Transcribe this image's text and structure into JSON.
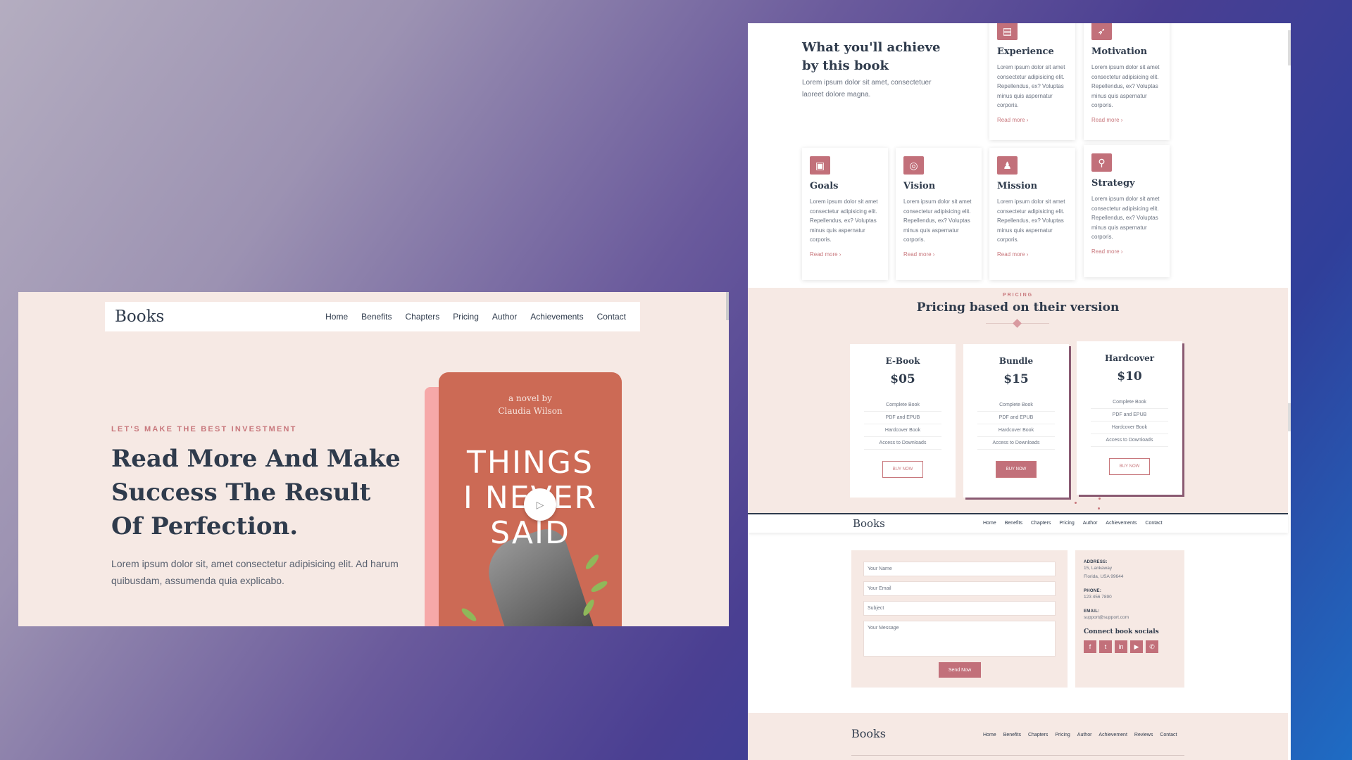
{
  "hero": {
    "brand": "Books",
    "nav": [
      "Home",
      "Benefits",
      "Chapters",
      "Pricing",
      "Author",
      "Achievements",
      "Contact"
    ],
    "tagline": "LET'S MAKE THE BEST INVESTMENT",
    "headline": "Read More And Make Success The Result Of Perfection.",
    "description": "Lorem ipsum dolor sit, amet consectetur adipisicing elit. Ad harum quibusdam, assumenda quia explicabo.",
    "book": {
      "byline": "a novel by",
      "author": "Claudia Wilson",
      "title_1": "THINGS",
      "title_2": "I NEVER",
      "title_3": "SAID"
    },
    "play_icon": "play-icon"
  },
  "achievements": {
    "title": "What you'll achieve by this book",
    "description": "Lorem ipsum dolor sit amet, consectetuer laoreet dolore magna.",
    "card_text": "Lorem ipsum dolor sit amet consectetur adipisicing elit. Repellendus, ex? Voluptas minus quis aspernatur corporis.",
    "read_more": "Read more ›",
    "cards": [
      {
        "title": "Experience",
        "icon": "book-icon"
      },
      {
        "title": "Motivation",
        "icon": "rocket-icon"
      },
      {
        "title": "Goals",
        "icon": "presentation-icon"
      },
      {
        "title": "Vision",
        "icon": "target-icon"
      },
      {
        "title": "Mission",
        "icon": "person-icon"
      },
      {
        "title": "Strategy",
        "icon": "strategy-icon"
      }
    ]
  },
  "pricing": {
    "tag": "PRICING",
    "title": "Pricing based on their version",
    "features": [
      "Complete Book",
      "PDF and EPUB",
      "Hardcover Book",
      "Access to Downloads"
    ],
    "plans": [
      {
        "name": "E-Book",
        "price": "$05",
        "button": "BUY NOW"
      },
      {
        "name": "Bundle",
        "price": "$15",
        "button": "BUY NOW"
      },
      {
        "name": "Hardcover",
        "price": "$10",
        "button": "BUY NOW"
      }
    ]
  },
  "nav2": {
    "brand": "Books",
    "items": [
      "Home",
      "Benefits",
      "Chapters",
      "Pricing",
      "Author",
      "Achievements",
      "Contact"
    ]
  },
  "contact": {
    "name_ph": "Your Name",
    "email_ph": "Your Email",
    "subject_ph": "Subject",
    "message_ph": "Your Message",
    "send": "Send Now",
    "address_label": "ADDRESS:",
    "address_1": "15, Lankaway",
    "address_2": "Florida, USA 99644",
    "phone_label": "PHONE:",
    "phone": "123 456 7890",
    "email_label": "EMAIL:",
    "email": "support@support.com",
    "socials_title": "Connect book socials",
    "socials": [
      "facebook-icon",
      "twitter-icon",
      "linkedin-icon",
      "youtube-icon",
      "whatsapp-icon"
    ]
  },
  "footer": {
    "brand": "Books",
    "items": [
      "Home",
      "Benefits",
      "Chapters",
      "Pricing",
      "Author",
      "Achievement",
      "Reviews",
      "Contact"
    ]
  },
  "colors": {
    "accent": "#c2707a",
    "cover": "#cc6a55",
    "panel_bg": "#f6e9e4",
    "heading": "#2f3b4c"
  }
}
